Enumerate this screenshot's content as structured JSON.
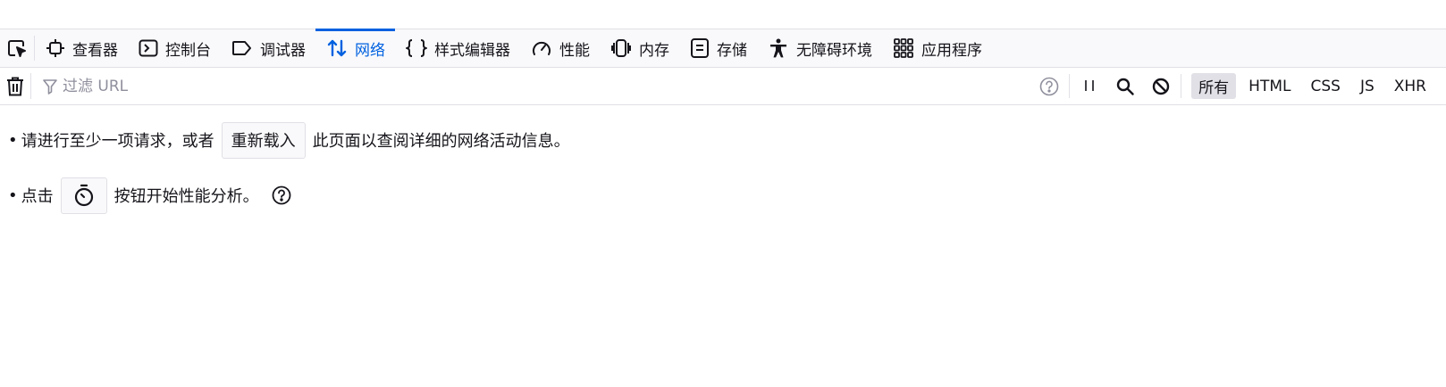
{
  "tabs": [
    {
      "label": "查看器",
      "icon": "inspector-icon"
    },
    {
      "label": "控制台",
      "icon": "console-icon"
    },
    {
      "label": "调试器",
      "icon": "debugger-icon"
    },
    {
      "label": "网络",
      "icon": "network-icon",
      "selected": true
    },
    {
      "label": "样式编辑器",
      "icon": "style-editor-icon"
    },
    {
      "label": "性能",
      "icon": "performance-icon"
    },
    {
      "label": "内存",
      "icon": "memory-icon"
    },
    {
      "label": "存储",
      "icon": "storage-icon"
    },
    {
      "label": "无障碍环境",
      "icon": "accessibility-icon"
    },
    {
      "label": "应用程序",
      "icon": "application-icon"
    }
  ],
  "toolbar": {
    "filter_placeholder": "过滤 URL",
    "type_filters": [
      {
        "label": "所有",
        "checked": true
      },
      {
        "label": "HTML"
      },
      {
        "label": "CSS"
      },
      {
        "label": "JS"
      },
      {
        "label": "XHR"
      }
    ]
  },
  "empty_notice": {
    "line1_prefix": "请进行至少一项请求，或者",
    "reload_button": "重新载入",
    "line1_suffix": "此页面以查阅详细的网络活动信息。",
    "line2_prefix": "点击",
    "line2_suffix": "按钮开始性能分析。",
    "bullet": "•"
  },
  "colors": {
    "accent": "#0061e0",
    "text": "#15141a",
    "muted": "#8f8f9d",
    "border": "#e0e0e6",
    "toolbar_bg": "#f9f9fb"
  }
}
